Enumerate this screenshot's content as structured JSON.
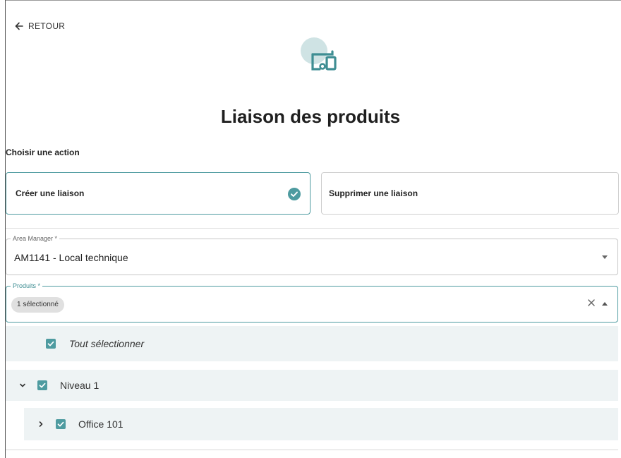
{
  "nav": {
    "back_label": "RETOUR"
  },
  "header": {
    "title": "Liaison des produits"
  },
  "actions": {
    "section_label": "Choisir une action",
    "create_label": "Créer une liaison",
    "delete_label": "Supprimer une liaison",
    "selected": "create"
  },
  "area_manager": {
    "label": "Area Manager *",
    "value": "AM1141 - Local technique"
  },
  "produits": {
    "label": "Produits *",
    "chip": "1 sélectionné"
  },
  "dropdown": {
    "select_all": "Tout sélectionner",
    "level": "Niveau 1",
    "office": "Office 101"
  },
  "colors": {
    "accent": "#4e9ba0",
    "option_bg": "#eef3f4",
    "icon_circle": "#cfe3e4"
  }
}
